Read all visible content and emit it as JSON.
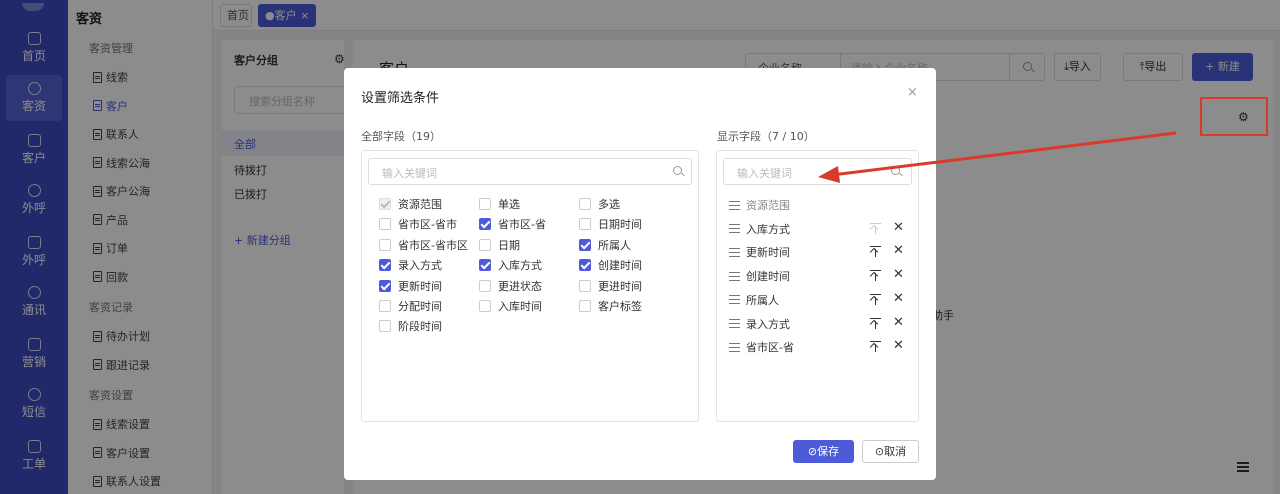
{
  "rail": {
    "items": [
      {
        "label": "首页",
        "icon": "home-icon"
      },
      {
        "label": "客资",
        "icon": "users-icon"
      },
      {
        "label": "客户",
        "icon": "user-icon"
      },
      {
        "label": "外呼",
        "icon": "phone-icon"
      },
      {
        "label": "外呼",
        "icon": "phone-out-icon"
      },
      {
        "label": "通讯",
        "icon": "calculator-icon"
      },
      {
        "label": "营销",
        "icon": "gear-icon"
      },
      {
        "label": "短信",
        "icon": "message-icon"
      },
      {
        "label": "工单",
        "icon": "clipboard-icon"
      }
    ]
  },
  "nav": {
    "brand": "客资",
    "sections": [
      {
        "title": "客资管理",
        "items": [
          "线索",
          "客户",
          "联系人",
          "线索公海",
          "客户公海",
          "产品",
          "订单",
          "回款"
        ]
      },
      {
        "title": "客资记录",
        "items": [
          "待办计划",
          "跟进记录"
        ]
      },
      {
        "title": "客资设置",
        "items": [
          "线索设置",
          "客户设置",
          "联系人设置"
        ]
      }
    ],
    "active_item": "客户"
  },
  "tabs": [
    {
      "label": "首页",
      "active": false
    },
    {
      "label": "●客户 ×",
      "active": true
    }
  ],
  "groups": {
    "title": "客户分组",
    "search_placeholder": "搜索分组名称",
    "items": [
      "全部",
      "待拨打",
      "已拨打"
    ],
    "new_group": "+ 新建分组"
  },
  "main": {
    "title": "客户",
    "filter_field": "企业名称  ⌄",
    "filter_placeholder": "请输入企业名称",
    "import_label": "⤓导入",
    "export_label": "⤒导出",
    "new_label": "+ 新建",
    "helper_text": "助手"
  },
  "modal": {
    "title": "设置筛选条件",
    "close": "×",
    "all_fields_title": "全部字段（19）",
    "shown_fields_title": "显示字段（7 / 10）",
    "search_placeholder": "输入关键词",
    "all_fields": [
      {
        "label": "资源范围",
        "checked": true,
        "disabled": true
      },
      {
        "label": "单选",
        "checked": false
      },
      {
        "label": "多选",
        "checked": false
      },
      {
        "label": "省市区-省市",
        "checked": false
      },
      {
        "label": "省市区-省",
        "checked": true
      },
      {
        "label": "日期时间",
        "checked": false
      },
      {
        "label": "省市区-省市区",
        "checked": false
      },
      {
        "label": "日期",
        "checked": false
      },
      {
        "label": "所属人",
        "checked": true
      },
      {
        "label": "录入方式",
        "checked": true
      },
      {
        "label": "入库方式",
        "checked": true
      },
      {
        "label": "创建时间",
        "checked": true
      },
      {
        "label": "更新时间",
        "checked": true
      },
      {
        "label": "更进状态",
        "checked": false
      },
      {
        "label": "更进时间",
        "checked": false
      },
      {
        "label": "分配时间",
        "checked": false
      },
      {
        "label": "入库时间",
        "checked": false
      },
      {
        "label": "客户标签",
        "checked": false
      },
      {
        "label": "阶段时间",
        "checked": false
      }
    ],
    "shown_fields": [
      {
        "label": "资源范围",
        "fixed": true
      },
      {
        "label": "入库方式",
        "fixed": false
      },
      {
        "label": "更新时间",
        "fixed": false
      },
      {
        "label": "创建时间",
        "fixed": false
      },
      {
        "label": "所属人",
        "fixed": false
      },
      {
        "label": "录入方式",
        "fixed": false
      },
      {
        "label": "省市区-省",
        "fixed": false
      }
    ],
    "save_label": "⊘保存",
    "cancel_label": "⊙取消"
  },
  "colors": {
    "primary": "#4e5bd9",
    "rail": "#3f4cc2",
    "annotation": "#d93b2a"
  }
}
